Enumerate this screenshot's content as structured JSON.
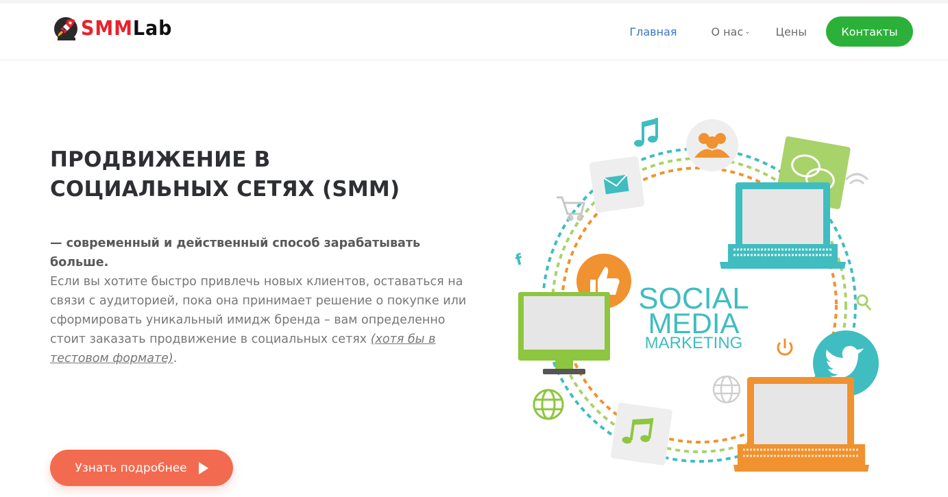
{
  "brand": {
    "logo_red": "SMM",
    "logo_dark": "Lab"
  },
  "nav": {
    "items": [
      {
        "label": "Главная",
        "active": true
      },
      {
        "label": "О нас",
        "has_dropdown": true
      },
      {
        "label": "Цены"
      }
    ],
    "cta_label": "Контакты"
  },
  "hero": {
    "title_line1": "ПРОДВИЖЕНИЕ В",
    "title_line2": "СОЦИАЛЬНЫХ СЕТЯХ (SMM)",
    "lead": " — современный и действенный способ зарабатывать больше.",
    "body": "Если вы хотите быстро привлечь новых клиентов, оставаться на связи с аудиторией, пока она принимает решение о покупке или сформировать уникальный имидж бренда – вам определенно стоит заказать продвижение в социальных сетях ",
    "body_link": "(хотя бы в тестовом формате)",
    "body_end": ".",
    "button_label": "Узнать подробнее"
  },
  "illustration": {
    "line1": "SOCIAL",
    "line2": "MEDIA",
    "line3": "MARKETING"
  },
  "colors": {
    "accent_blue": "#3575c9",
    "cta_green": "#2bb13a",
    "button_orange": "#f26a4f",
    "teal": "#3fbdc0",
    "lime": "#8dc63f",
    "orange": "#f0922f"
  }
}
